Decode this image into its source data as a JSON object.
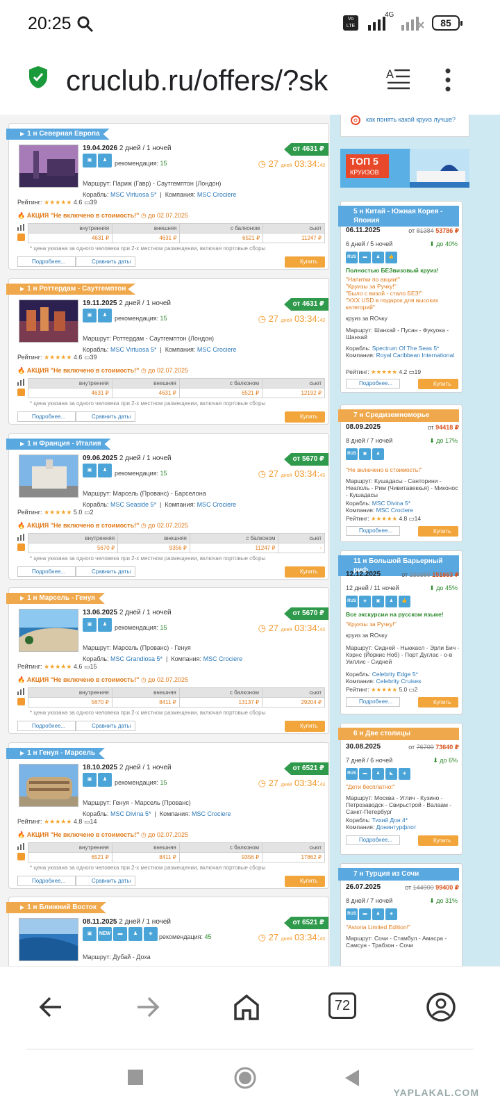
{
  "status": {
    "time": "20:25",
    "network": "4G",
    "volte": "Vo LTE",
    "battery": "85"
  },
  "browser": {
    "url": "cruclub.ru/offers/?sk",
    "tabs_count": "72"
  },
  "labels": {
    "days": "дней",
    "recommend": "рекомендация:",
    "route": "Маршрут:",
    "ship": "Корабль:",
    "company": "Компания:",
    "rating": "Рейтинг:",
    "note": "* цена указана за одного человека при 2-х местном размещении, включая портовые сборы",
    "more": "Подробнее...",
    "compare": "Сравнить даты",
    "buy": "Купить",
    "price_prefix": "от",
    "cols": [
      "внутренняя",
      "внешняя",
      "с балконом",
      "сьют"
    ],
    "help_link": "как понять какой круиз лучше?",
    "ship_r": "Корабль:",
    "company_r": "Компания:"
  },
  "offers": [
    {
      "title": "1 н Северная Европа",
      "color": "blue",
      "date": "19.04.2026",
      "duration": "2 дней / 1 ночей",
      "rec": "15",
      "route": "Париж (Гавр) - Саутгемптон (Лондон)",
      "ship": "MSC Virtuosa 5*",
      "company": "MSC Crociere",
      "price": "от 4631 ₽",
      "timer": "27",
      "timer_time": "03:34:",
      "timer_sec": "43",
      "stars": "★★★★★",
      "rating": "4.6",
      "reviews": "39",
      "promo": "АКЦИЯ \"Не включено в стоимость!\"",
      "promo_date": "до 02.07.2025",
      "prices": [
        "4631 ₽",
        "4631 ₽",
        "6521 ₽",
        "11247 ₽"
      ]
    },
    {
      "title": "1 н Роттердам - Саутгемптон",
      "color": "orange",
      "date": "19.11.2025",
      "duration": "2 дней / 1 ночей",
      "rec": "15",
      "route": "Роттердам - Саутгемптон (Лондон)",
      "ship": "MSC Virtuosa 5*",
      "company": "MSC Crociere",
      "price": "от 4631 ₽",
      "timer": "27",
      "timer_time": "03:34:",
      "timer_sec": "43",
      "stars": "★★★★★",
      "rating": "4.6",
      "reviews": "39",
      "promo": "АКЦИЯ \"Не включено в стоимость!\"",
      "promo_date": "до 02.07.2025",
      "prices": [
        "4631 ₽",
        "4631 ₽",
        "6521 ₽",
        "12192 ₽"
      ]
    },
    {
      "title": "1 н Франция - Италия",
      "color": "blue",
      "date": "09.06.2025",
      "duration": "2 дней / 1 ночей",
      "rec": "15",
      "route": "Марсель (Прованс) - Барселона",
      "ship": "MSC Seaside 5*",
      "company": "MSC Crociere",
      "price": "от 5670 ₽",
      "timer": "27",
      "timer_time": "03:34:",
      "timer_sec": "43",
      "stars": "★★★★★",
      "rating": "5.0",
      "reviews": "2",
      "promo": "АКЦИЯ \"Не включено в стоимость!\"",
      "promo_date": "до 02.07.2025",
      "prices": [
        "5670 ₽",
        "9356 ₽",
        "11247 ₽",
        "-"
      ]
    },
    {
      "title": "1 н Марсель - Генуя",
      "color": "orange",
      "date": "13.06.2025",
      "duration": "2 дней / 1 ночей",
      "rec": "15",
      "route": "Марсель (Прованс) - Генуя",
      "ship": "MSC Grandiosa 5*",
      "company": "MSC Crociere",
      "price": "от 5670 ₽",
      "timer": "27",
      "timer_time": "03:34:",
      "timer_sec": "43",
      "stars": "★★★★★",
      "rating": "4.6",
      "reviews": "15",
      "promo": "АКЦИЯ \"Не включено в стоимость!\"",
      "promo_date": "до 02.07.2025",
      "prices": [
        "5670 ₽",
        "8411 ₽",
        "13137 ₽",
        "29204 ₽"
      ]
    },
    {
      "title": "1 н Генуя - Марсель",
      "color": "blue",
      "date": "18.10.2025",
      "duration": "2 дней / 1 ночей",
      "rec": "15",
      "route": "Генуя - Марсель (Прованс)",
      "ship": "MSC Divina 5*",
      "company": "MSC Crociere",
      "price": "от 6521 ₽",
      "timer": "27",
      "timer_time": "03:34:",
      "timer_sec": "43",
      "stars": "★★★★★",
      "rating": "4.8",
      "reviews": "14",
      "promo": "АКЦИЯ \"Не включено в стоимость!\"",
      "promo_date": "до 02.07.2025",
      "prices": [
        "6521 ₽",
        "8411 ₽",
        "9356 ₽",
        "17862 ₽"
      ]
    },
    {
      "title": "1 н Ближний Восток",
      "color": "orange",
      "date": "08.11.2025",
      "duration": "2 дней / 1 ночей",
      "rec": "45",
      "route": "Дубай - Доха",
      "price": "от 6521 ₽",
      "timer": "27",
      "timer_time": "03:34:",
      "timer_sec": "43"
    }
  ],
  "top5": {
    "title": "ТОП 5",
    "sub": "КРУИЗОВ"
  },
  "side": [
    {
      "title": "5 н Китай - Южная Корея - Япония",
      "color": "blue",
      "date": "06.11.2025",
      "old": "81384",
      "new": "53786 ₽",
      "price_prefix": "от",
      "days": "6 дней / 5 ночей",
      "disc": "до 40%",
      "lines": [
        "Полностью БЕЗвизовый круиз!",
        "\"Напитки по акции!\"",
        "\"Круизы за Ручку!\"",
        "\"Было с визой - стало БЕЗ!\"",
        "\"XXX USD в подарок для высоких категорий\"",
        "круиз за ROчку"
      ],
      "route": "Маршрут: Шанхай - Пусан - Фукуока - Шанхай",
      "ship": "Spectrum Of The Seas 5*",
      "company": "Royal Caribbean International",
      "stars": "★★★★★",
      "rating": "4.2",
      "reviews": "19"
    },
    {
      "title": "7 н Средиземноморье",
      "color": "orange",
      "date": "08.09.2025",
      "old": "",
      "new": "94418 ₽",
      "price_prefix": "от",
      "days": "8 дней / 7 ночей",
      "disc": "до 17%",
      "lines": [
        "\"Не включено в стоимость!\""
      ],
      "route": "Маршрут: Кушадасы - Санторини - Неаполь - Рим (Чивитавеккья) - Миконос - Кушадасы",
      "ship": "MSC Divina 5*",
      "company": "MSC Crociere",
      "stars": "★★★★★",
      "rating": "4.8",
      "reviews": "14"
    },
    {
      "title": "11 н Большой Барьерный риф",
      "color": "blue",
      "date": "12.12.2025",
      "old": "233380",
      "new": "151663 ₽",
      "price_prefix": "от",
      "days": "12 дней / 11 ночей",
      "disc": "до 45%",
      "lines": [
        "Все экскурсии на русском языке!",
        "\"Круизы за Ручку!\"",
        "круиз за ROчку"
      ],
      "route": "Маршрут: Сидней - Ньюкасл - Эрли Бич - Кэрнс (Йоркис Ноб) - Порт Дуглас - о-в Уиллис - Сидней",
      "ship": "Celebrity Edge 5*",
      "company": "Celebrity Cruises",
      "stars": "★★★★★",
      "rating": "5.0",
      "reviews": "2"
    },
    {
      "title": "6 н Две столицы",
      "color": "orange",
      "date": "30.08.2025",
      "old": "76709",
      "new": "73640 ₽",
      "price_prefix": "от",
      "days": "7 дней / 6 ночей",
      "disc": "до 6%",
      "lines": [
        "\"Дети бесплатно!\""
      ],
      "route": "Маршрут: Москва - Углич - Кузино - Петрозаводск - Свирьстрой - Валаам - Санкт-Петербург",
      "ship": "Тихий Дон 4*",
      "company": "Донинтурфлот"
    },
    {
      "title": "7 н Турция из Сочи",
      "color": "blue",
      "date": "26.07.2025",
      "old": "144900",
      "new": "99400 ₽",
      "price_prefix": "от",
      "days": "8 дней / 7 ночей",
      "disc": "до 31%",
      "lines": [
        "\"Astoria Limited Edition!\""
      ],
      "route": "Маршрут: Сочи - Стамбул - Амасра - Самсун - Трабзон - Сочи"
    }
  ],
  "watermark": "YAPLAKAL.COM"
}
